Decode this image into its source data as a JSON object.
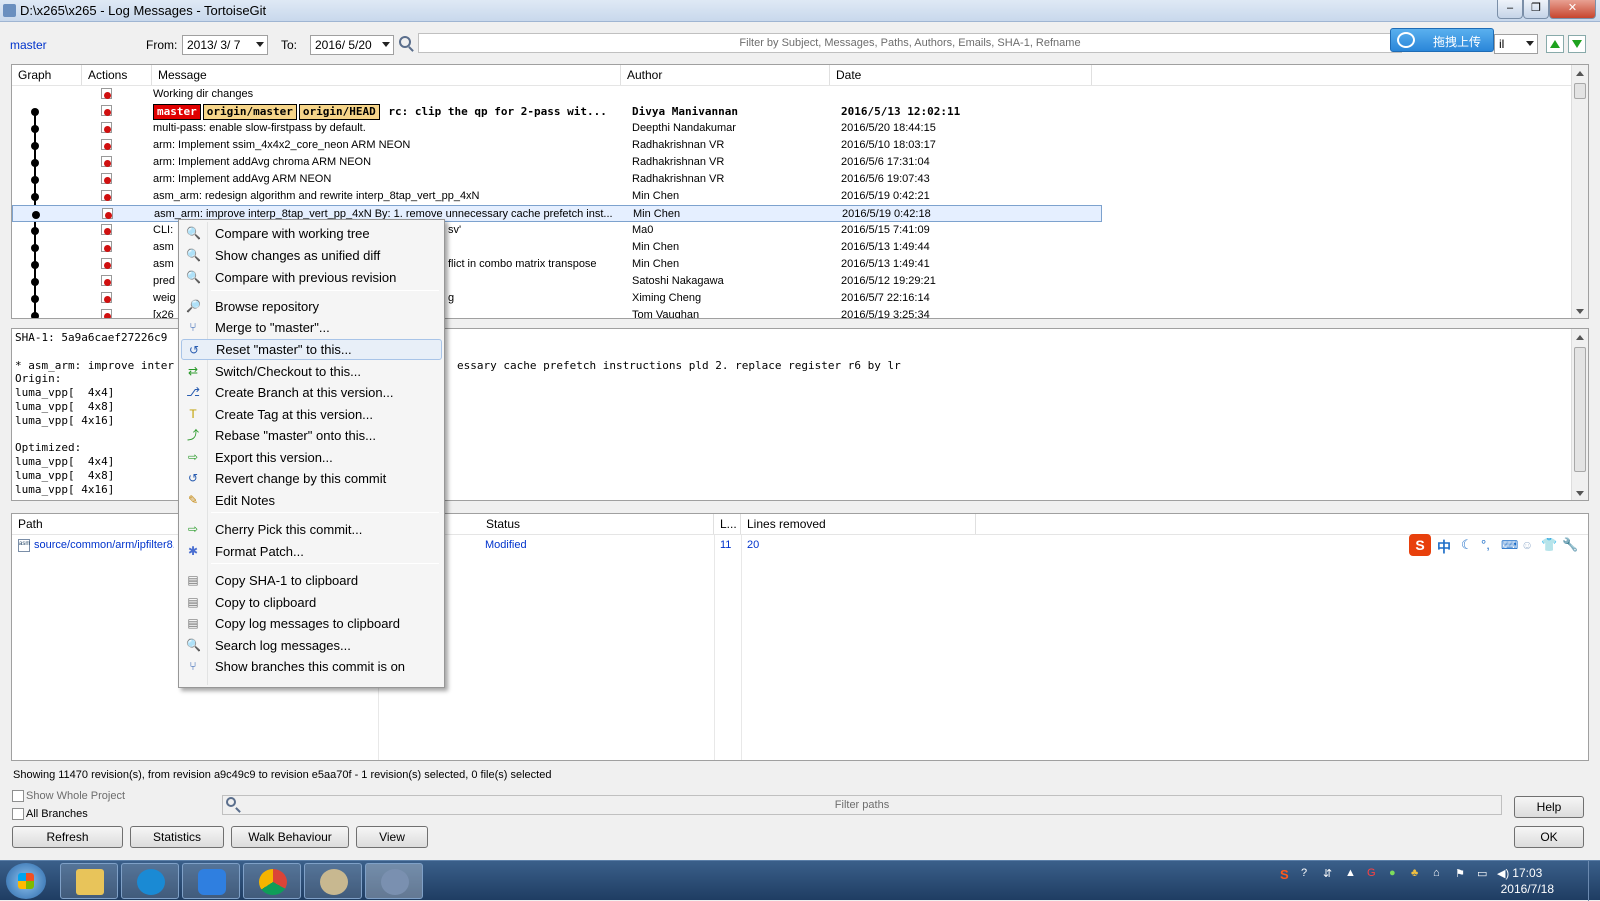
{
  "window": {
    "title": "D:\\x265\\x265 - Log Messages - TortoiseGit"
  },
  "toolbar": {
    "branch_link": "master",
    "from_label": "From:",
    "from_value": "2013/ 3/ 7",
    "to_label": "To:",
    "to_value": "2016/ 5/20",
    "filter_placeholder": "Filter by Subject, Messages, Paths, Authors, Emails, SHA-1, Refname",
    "upload_button": "拖拽上传",
    "filter_mode_value": "il"
  },
  "log": {
    "columns": [
      "Graph",
      "Actions",
      "Message",
      "Author",
      "Date"
    ],
    "rows": [
      {
        "message": "Working dir changes",
        "author": "",
        "date": "",
        "style": "plain"
      },
      {
        "message": "rc: clip the qp for 2-pass wit...",
        "author": "Divya Manivannan",
        "date": "2016/5/13 12:02:11",
        "style": "head",
        "refs": [
          "master",
          "origin/master",
          "origin/HEAD"
        ]
      },
      {
        "message": "multi-pass: enable slow-firstpass by default.",
        "author": "Deepthi Nandakumar",
        "date": "2016/5/20 18:44:15",
        "style": "plain"
      },
      {
        "message": "arm: Implement ssim_4x4x2_core_neon ARM NEON",
        "author": "Radhakrishnan VR",
        "date": "2016/5/10 18:03:17",
        "style": "plain"
      },
      {
        "message": "arm: Implement addAvg chroma ARM NEON",
        "author": "Radhakrishnan VR",
        "date": "2016/5/6 17:31:04",
        "style": "plain"
      },
      {
        "message": "arm: Implement addAvg ARM NEON",
        "author": "Radhakrishnan VR",
        "date": "2016/5/6 19:07:43",
        "style": "plain"
      },
      {
        "message": "asm_arm: redesign algorithm and rewrite interp_8tap_vert_pp_4xN",
        "author": "Min Chen",
        "date": "2016/5/19 0:42:21",
        "style": "plain"
      },
      {
        "message": "asm_arm: improve interp_8tap_vert_pp_4xN By: 1. remove unnecessary cache prefetch inst...",
        "author": "Min Chen",
        "date": "2016/5/19 0:42:18",
        "style": "selected"
      },
      {
        "message": "CLI:",
        "message_tail": "sv'",
        "author": "Ma0",
        "date": "2016/5/15 7:41:09",
        "style": "plain"
      },
      {
        "message": "asm",
        "message_tail": "",
        "author": "Min Chen",
        "date": "2016/5/13 1:49:44",
        "style": "plain"
      },
      {
        "message": "asm",
        "message_tail": "flict in combo matrix transpose",
        "author": "Min Chen",
        "date": "2016/5/13 1:49:41",
        "style": "plain"
      },
      {
        "message": "pred",
        "message_tail": "",
        "author": "Satoshi Nakagawa",
        "date": "2016/5/12 19:29:21",
        "style": "plain"
      },
      {
        "message": "weig",
        "message_tail": "g",
        "author": "Ximing Cheng",
        "date": "2016/5/7 22:16:14",
        "style": "plain"
      },
      {
        "message": "[x26",
        "message_tail": "",
        "author": "Tom Vaughan",
        "date": "2016/5/19 3:25:34",
        "style": "plain"
      }
    ]
  },
  "details": {
    "lines": [
      "SHA-1: 5a9a6caef27226c9",
      "",
      "* asm_arm: improve inter",
      "Origin:",
      "luma_vpp[  4x4]",
      "luma_vpp[  4x8]",
      "luma_vpp[ 4x16]",
      "",
      "Optimized:",
      "luma_vpp[  4x4]",
      "luma_vpp[  4x8]",
      "luma_vpp[ 4x16]"
    ],
    "line3_tail": "essary cache prefetch instructions pld 2. replace register r6 by lr"
  },
  "files": {
    "columns": [
      "Path",
      "Status",
      "L...",
      "Lines removed"
    ],
    "rows": [
      {
        "path": "source/common/arm/ipfilter8.S",
        "status": "Modified",
        "added": "11",
        "removed": "20"
      }
    ]
  },
  "context_menu": {
    "items": [
      {
        "label": "Compare with working tree",
        "icon": "magnifier-icon"
      },
      {
        "label": "Show changes as unified diff",
        "icon": "magnifier-icon"
      },
      {
        "label": "Compare with previous revision",
        "icon": "magnifier-icon"
      },
      {
        "label": "Browse repository",
        "icon": "browse-icon"
      },
      {
        "label": "Merge to \"master\"...",
        "icon": "merge-icon"
      },
      {
        "label": "Reset \"master\" to this...",
        "icon": "reset-icon"
      },
      {
        "label": "Switch/Checkout to this...",
        "icon": "switch-icon"
      },
      {
        "label": "Create Branch at this version...",
        "icon": "branch-icon"
      },
      {
        "label": "Create Tag at this version...",
        "icon": "tag-icon"
      },
      {
        "label": "Rebase \"master\" onto this...",
        "icon": "rebase-icon"
      },
      {
        "label": "Export this version...",
        "icon": "export-icon"
      },
      {
        "label": "Revert change by this commit",
        "icon": "revert-icon"
      },
      {
        "label": "Edit Notes",
        "icon": "pencil-icon"
      },
      {
        "label": "Cherry Pick this commit...",
        "icon": "cherry-pick-icon"
      },
      {
        "label": "Format Patch...",
        "icon": "patch-icon"
      },
      {
        "label": "Copy SHA-1 to clipboard",
        "icon": "clipboard-icon"
      },
      {
        "label": "Copy to clipboard",
        "icon": "clipboard-icon"
      },
      {
        "label": "Copy log messages to clipboard",
        "icon": "clipboard-icon"
      },
      {
        "label": "Search log messages...",
        "icon": "search-icon"
      },
      {
        "label": "Show branches this commit is on",
        "icon": "branches-icon"
      }
    ]
  },
  "status": {
    "text": "Showing 11470 revision(s), from revision a9c49c9 to revision e5aa70f - 1 revision(s) selected, 0 file(s) selected"
  },
  "bottom": {
    "show_whole_project": "Show Whole Project",
    "all_branches": "All Branches",
    "filter_paths_placeholder": "Filter paths",
    "buttons": {
      "refresh": "Refresh",
      "statistics": "Statistics",
      "walk_behaviour": "Walk Behaviour",
      "view": "View",
      "help": "Help",
      "ok": "OK"
    }
  },
  "ime": {
    "lang": "中"
  },
  "taskbar": {
    "time": "17:03",
    "date": "2016/7/18"
  }
}
